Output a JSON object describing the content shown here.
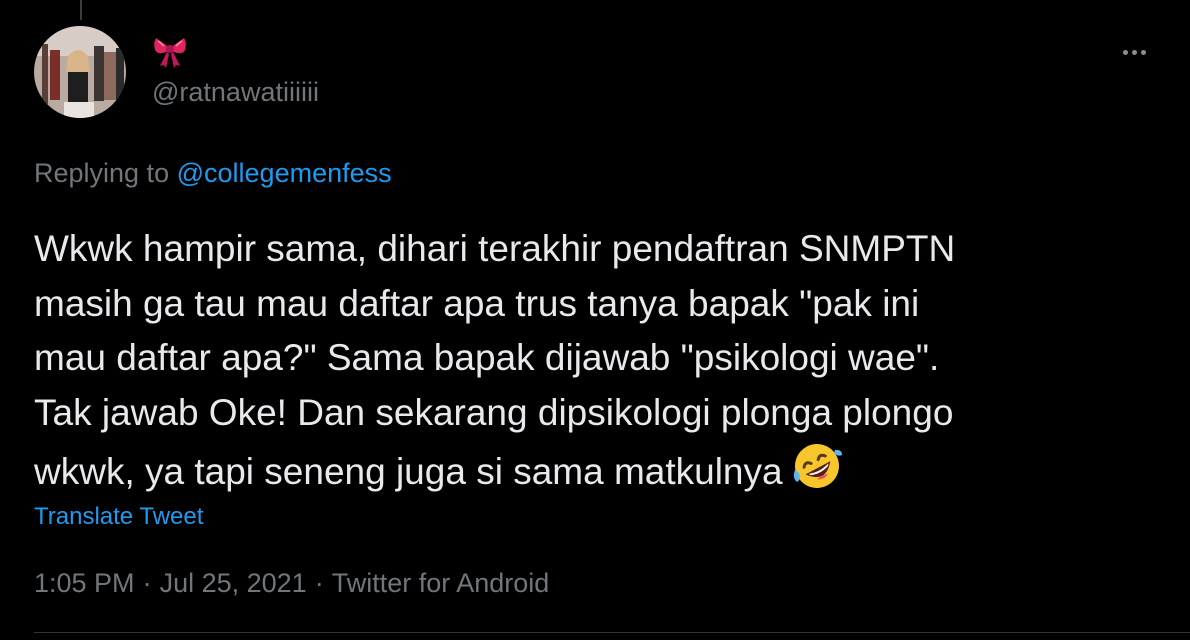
{
  "tweet": {
    "display_name_icon": "ribbon-bow-emoji",
    "display_name": "🎀",
    "handle": "@ratnawatiiiiii",
    "replying_prefix": "Replying to",
    "replying_to": "@collegemenfess",
    "text_lines": [
      "Wkwk hampir sama, dihari terakhir pendaftran SNMPTN",
      "masih ga tau mau daftar apa trus tanya bapak \"pak ini",
      "mau daftar apa?\" Sama bapak dijawab \"psikologi wae\".",
      "Tak jawab Oke! Dan sekarang dipsikologi plonga plongo",
      "wkwk, ya tapi seneng juga si sama matkulnya"
    ],
    "trailing_emoji": "rolling-on-floor-laughing-emoji",
    "translate_label": "Translate Tweet",
    "time": "1:05 PM",
    "date": "Jul 25, 2021",
    "source": "Twitter for Android",
    "separator": "·"
  },
  "colors": {
    "background": "#000000",
    "text": "#e7e9ea",
    "secondary": "#71767b",
    "accent": "#1d9bf0",
    "divider": "#2f3336"
  },
  "icons": {
    "more": "more-horizontal-icon",
    "avatar": "profile-photo"
  }
}
